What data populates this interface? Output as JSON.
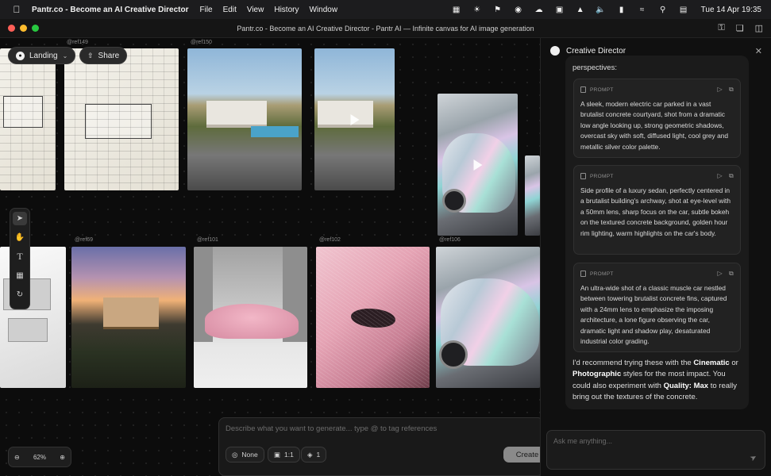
{
  "menubar": {
    "app_name": "Pantr.co - Become an AI Creative Director",
    "menus": [
      "File",
      "Edit",
      "View",
      "History",
      "Window"
    ],
    "datetime": "Tue 14 Apr  19:35"
  },
  "window": {
    "title": "Pantr.co - Become an AI Creative Director - Pantr AI — Infinite canvas for AI image generation"
  },
  "canvas": {
    "board_name": "Landing",
    "share_label": "Share",
    "refs": {
      "r149": "@ref149",
      "r150": "@ref150",
      "r69": "@ref69",
      "r101": "@ref101",
      "r102": "@ref102",
      "r106": "@ref106"
    },
    "zoom_level": "62%",
    "prompt_placeholder": "Describe what you want to generate... type @ to tag references",
    "chips": {
      "style": "None",
      "ratio": "1:1",
      "count": "1"
    },
    "create_label": "Create"
  },
  "panel": {
    "title": "Creative Director",
    "lead_text": "perspectives:",
    "prompt_label": "PROMPT",
    "prompts": [
      "A sleek, modern electric car parked in a vast brutalist concrete courtyard, shot from a dramatic low angle looking up, strong geometric shadows, overcast sky with soft, diffused light, cool grey and metallic silver color palette.",
      "Side profile of a luxury sedan, perfectly centered in a brutalist building's archway, shot at eye-level with a 50mm lens, sharp focus on the car, subtle bokeh on the textured concrete background, golden hour rim lighting, warm highlights on the car's body.",
      "An ultra-wide shot of a classic muscle car nestled between towering brutalist concrete fins, captured with a 24mm lens to emphasize the imposing architecture, a lone figure observing the car, dramatic light and shadow play, desaturated industrial color grading."
    ],
    "recommendation": {
      "t1": "I'd recommend trying these with the ",
      "b1": "Cinematic",
      "t2": " or ",
      "b2": "Photographic",
      "t3": " styles for the most impact. You could also experiment with ",
      "b3": "Quality: Max",
      "t4": " to really bring out the textures of the concrete."
    },
    "ask_placeholder": "Ask me anything..."
  },
  "colors": {
    "background": "#0b0b0b",
    "panel": "#101010",
    "traffic_red": "#ff5f57",
    "traffic_yellow": "#febc2e",
    "traffic_green": "#28c840"
  }
}
